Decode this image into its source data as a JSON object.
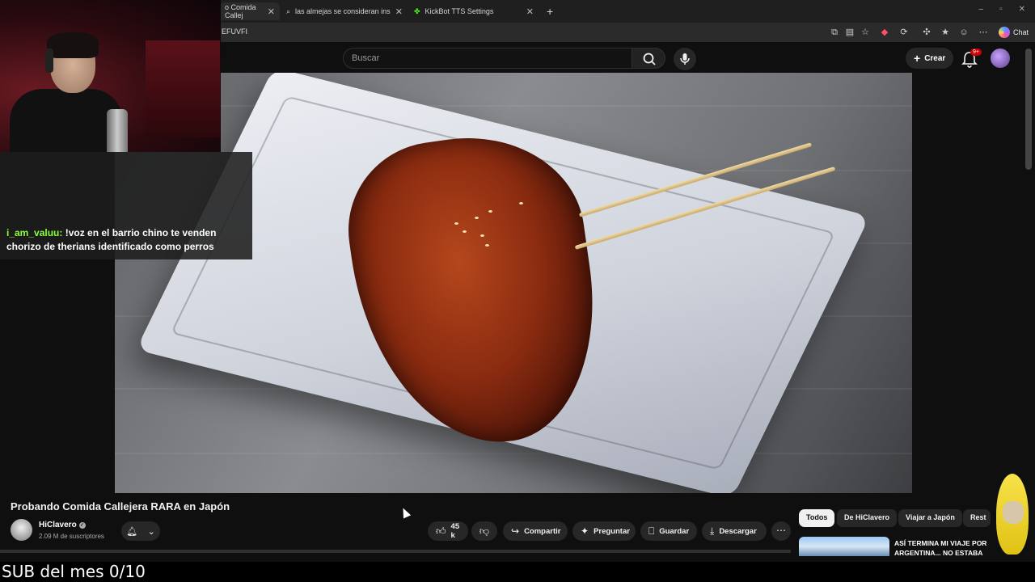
{
  "browser": {
    "tabs": [
      {
        "label": "o Comida Callej",
        "icon": "youtube-icon"
      },
      {
        "label": "las almejas se consideran insectos",
        "icon": "search-icon"
      },
      {
        "label": "KickBot TTS Settings",
        "icon": "kickbot-icon"
      }
    ],
    "new_tab": "+",
    "address": "EFUVFI",
    "chat_label": "Chat"
  },
  "youtube": {
    "search_placeholder": "Buscar",
    "create_label": "Crear",
    "notifications_badge": "9+",
    "video_title": "Probando Comida Callejera RARA en Japón",
    "channel_name": "HiClavero",
    "subscribers": "2.09 M de suscriptores",
    "likes": "45 k",
    "actions": {
      "share": "Compartir",
      "ask": "Preguntar",
      "save": "Guardar",
      "download": "Descargar"
    },
    "chips": [
      "Todos",
      "De HiClavero",
      "Viajar a Japón",
      "Rest"
    ],
    "recommended_title": "ASÍ TERMINA MI VIAJE POR ARGENTINA... NO ESTABA"
  },
  "chat": {
    "user": "i_am_valuu:",
    "message": " !voz en el barrio chino te venden chorizo de therians identificado como perros"
  },
  "stream": {
    "sub_goal": "SUB del mes 0/10"
  }
}
